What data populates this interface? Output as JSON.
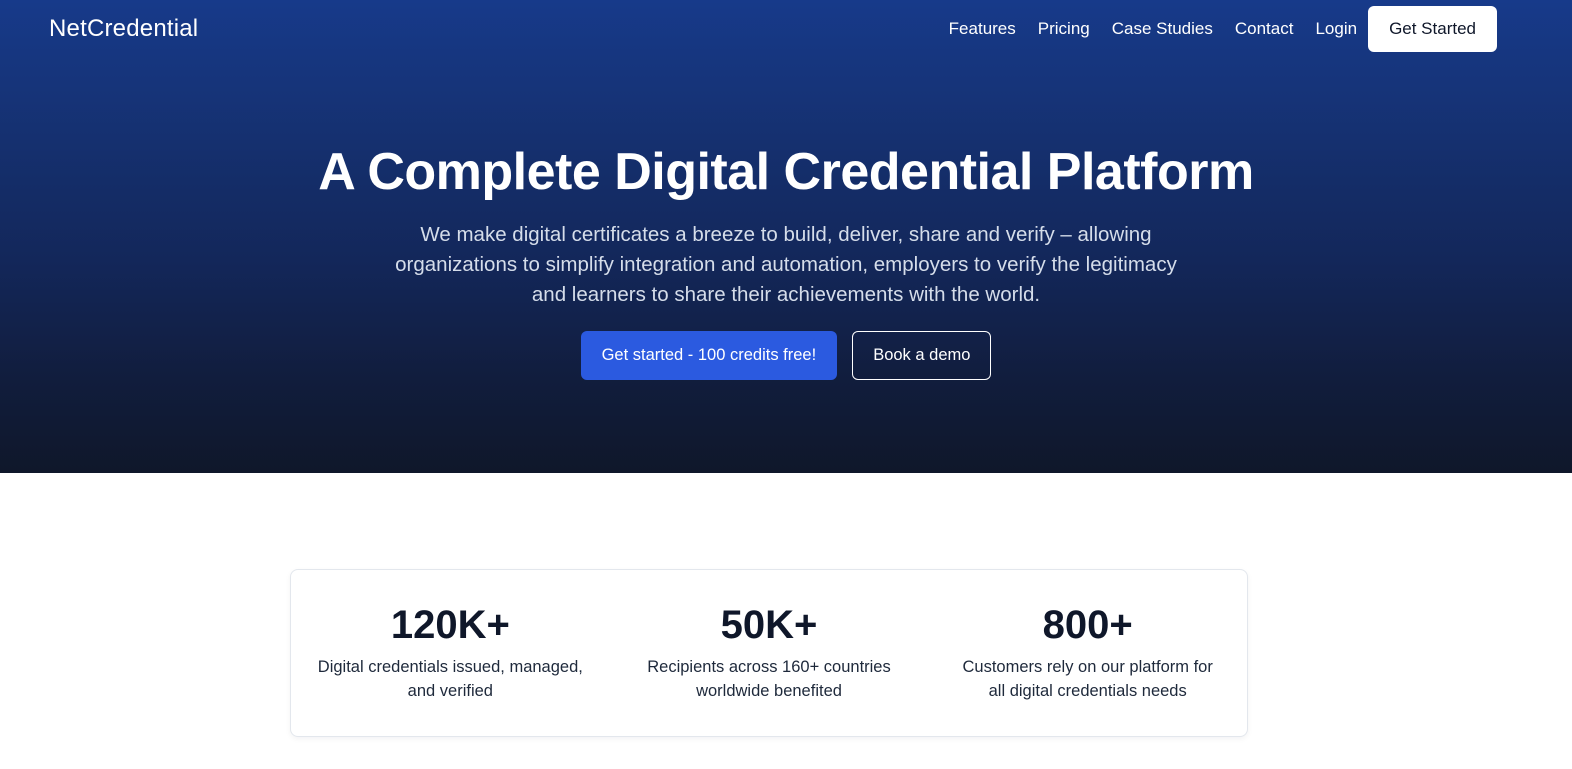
{
  "brand": {
    "name": "NetCredential"
  },
  "nav": {
    "links": [
      "Features",
      "Pricing",
      "Case Studies",
      "Contact",
      "Login"
    ],
    "cta": "Get Started"
  },
  "hero": {
    "title": "A Complete Digital Credential Platform",
    "subtitle": "We make digital certificates a breeze to build, deliver, share and verify – allowing organizations to simplify integration and automation, employers to verify the legitimacy and learners to share their achievements with the world.",
    "primary_cta": "Get started - 100 credits free!",
    "secondary_cta": "Book a demo"
  },
  "stats": [
    {
      "value": "120K+",
      "desc": "Digital credentials issued, managed, and verified"
    },
    {
      "value": "50K+",
      "desc": "Recipients across 160+ countries worldwide benefited"
    },
    {
      "value": "800+",
      "desc": "Customers rely on our platform for all digital credentials needs"
    }
  ],
  "colors": {
    "hero_top": "#173a8a",
    "hero_bottom": "#0f172a",
    "primary": "#2b5ae0",
    "text_dark": "#0f172a"
  }
}
